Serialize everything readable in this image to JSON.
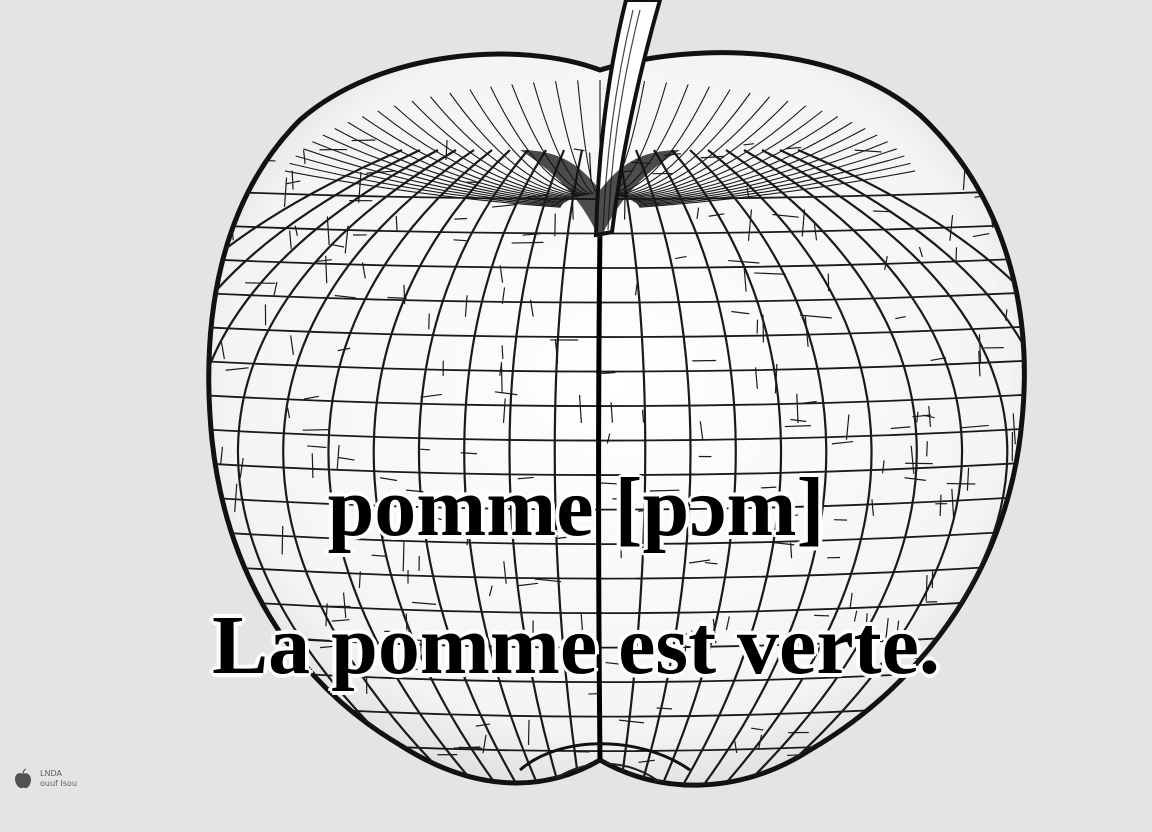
{
  "caption": {
    "word": "pomme [pɔm]",
    "sentence": "La pomme est verte."
  },
  "image": {
    "subject": "apple-illustration",
    "style": "black-and-white line drawing with cracked tile pattern",
    "background_color": "#e4e4e6",
    "line_color": "#1a1a1a"
  },
  "watermark": {
    "icon": "apple-logo-icon",
    "line1": "LNDA",
    "line2": "ouuf Isou"
  }
}
